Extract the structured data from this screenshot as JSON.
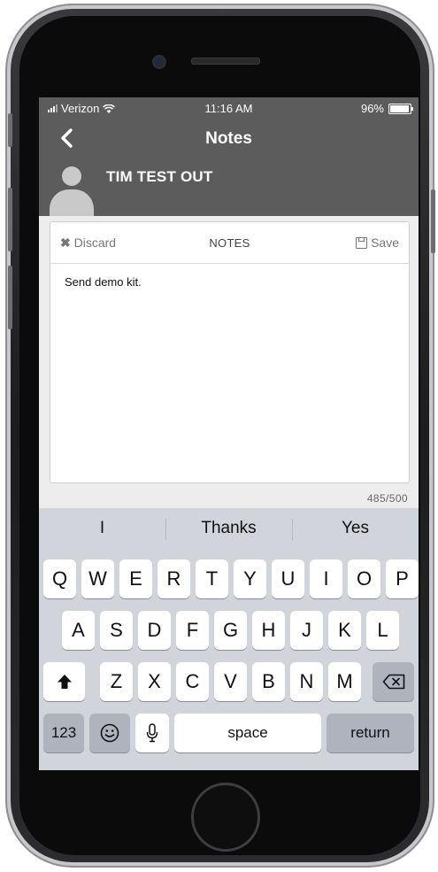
{
  "status": {
    "carrier": "Verizon",
    "time": "11:16 AM",
    "battery": "96%",
    "battery_level": 0.96
  },
  "header": {
    "title": "Notes",
    "contact_name": "TIM TEST OUT"
  },
  "note": {
    "discard_label": "Discard",
    "title": "NOTES",
    "save_label": "Save",
    "text": "Send demo kit.",
    "counter": "485/500"
  },
  "keyboard": {
    "suggestions": [
      "I",
      "Thanks",
      "Yes"
    ],
    "row1": [
      "Q",
      "W",
      "E",
      "R",
      "T",
      "Y",
      "U",
      "I",
      "O",
      "P"
    ],
    "row2": [
      "A",
      "S",
      "D",
      "F",
      "G",
      "H",
      "J",
      "K",
      "L"
    ],
    "row3": [
      "Z",
      "X",
      "C",
      "V",
      "B",
      "N",
      "M"
    ],
    "numbers_label": "123",
    "space_label": "space",
    "return_label": "return"
  },
  "icons": [
    "back-chevron-icon",
    "wifi-icon",
    "battery-icon",
    "avatar-icon",
    "close-icon",
    "save-icon",
    "shift-icon",
    "emoji-icon",
    "microphone-icon",
    "backspace-icon"
  ]
}
